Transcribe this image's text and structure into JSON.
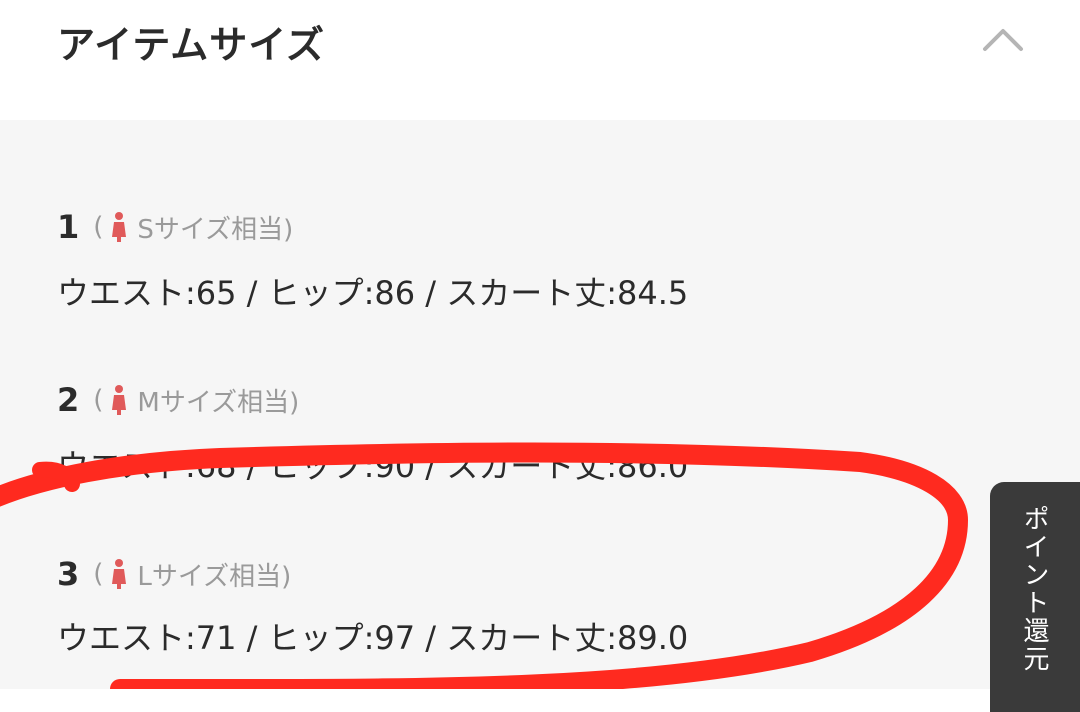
{
  "header": {
    "title": "アイテムサイズ",
    "collapse_icon": "chevron-up-icon"
  },
  "sizes": [
    {
      "number": "1",
      "paren_open": "(",
      "equiv": "Sサイズ相当)",
      "measurements": "ウエスト:65 / ヒップ:86 / スカート丈:84.5"
    },
    {
      "number": "2",
      "paren_open": "(",
      "equiv": "Mサイズ相当)",
      "measurements": "ウエスト:68 / ヒップ:90 / スカート丈:86.0"
    },
    {
      "number": "3",
      "paren_open": "(",
      "equiv": "Lサイズ相当)",
      "measurements": "ウエスト:71 / ヒップ:97 / スカート丈:89.0"
    }
  ],
  "point_tab": {
    "label": "ポイント還元"
  },
  "colors": {
    "accent_icon": "#e05a5a",
    "annotation": "#ff2a1f",
    "tab_bg": "#3a3a3a"
  }
}
